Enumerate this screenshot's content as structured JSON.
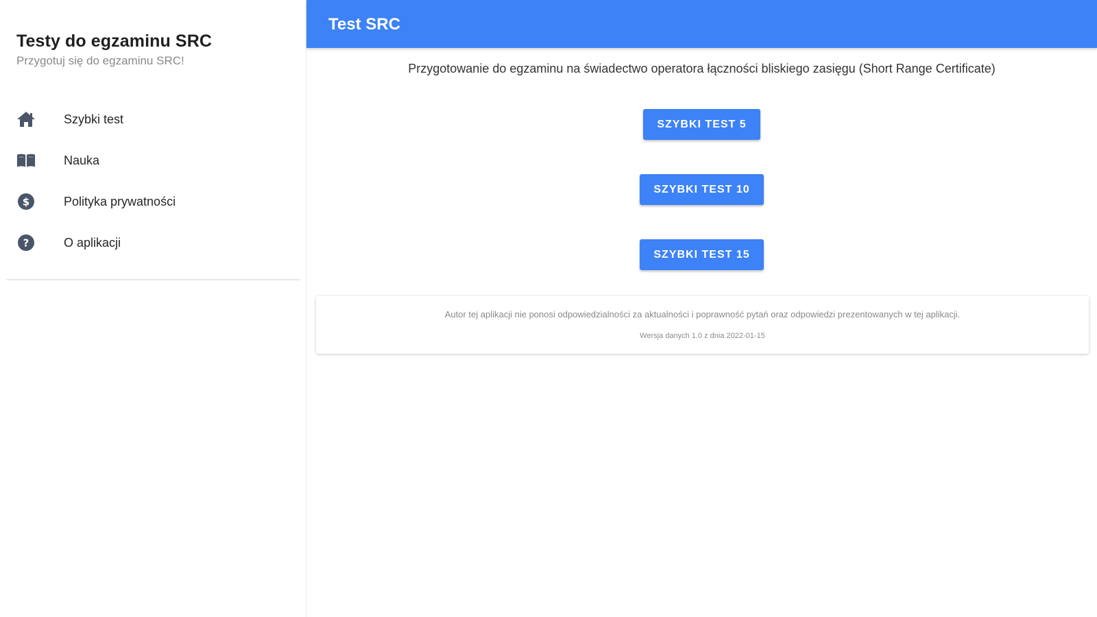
{
  "sidebar": {
    "app_name": "Testy do egzaminu SRC",
    "tagline": "Przygotuj się do egzaminu SRC!",
    "items": [
      {
        "label": "Szybki test",
        "icon": "home-icon"
      },
      {
        "label": "Nauka",
        "icon": "book-icon"
      },
      {
        "label": "Polityka prywatności",
        "icon": "dollar-circle-icon"
      },
      {
        "label": "O aplikacji",
        "icon": "help-circle-icon"
      }
    ]
  },
  "main": {
    "title": "Test SRC",
    "intro": "Przygotowanie do egzaminu na świadectwo operatora łączności bliskiego zasięgu (Short Range Certificate)",
    "buttons": [
      {
        "label": "SZYBKI TEST 5"
      },
      {
        "label": "SZYBKI TEST 10"
      },
      {
        "label": "SZYBKI TEST 15"
      }
    ],
    "disclaimer": "Autor tej aplikacji nie ponosi odpowiedzialności za aktualności i poprawność pytań oraz odpowiedzi prezentowanych w tej aplikacji.",
    "version": "Wersja danych 1.0 z dnia 2022-01-15"
  },
  "colors": {
    "primary": "#3d82f6",
    "icon": "#4a5568",
    "text": "#212121",
    "muted": "#8a8a8a"
  }
}
